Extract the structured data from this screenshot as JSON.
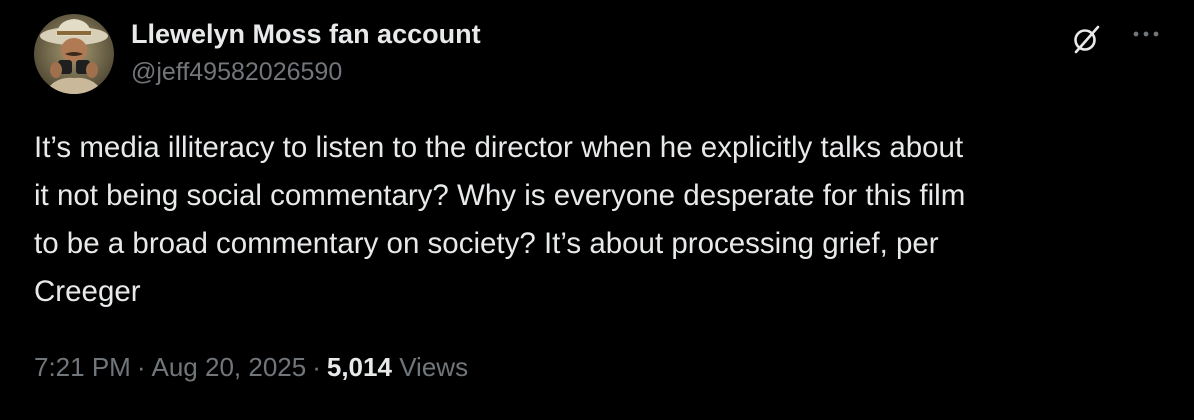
{
  "tweet": {
    "author": {
      "display_name": "Llewelyn Moss fan account",
      "handle": "@jeff49582026590"
    },
    "text": "It’s media illiteracy to listen to the director when he explicitly talks about\nit not being social commentary? Why is everyone desperate for this film\nto be a broad commentary on society? It’s about processing grief, per\nCreeger",
    "time": "7:21 PM",
    "date": "Aug 20, 2025",
    "separator": "·",
    "views_count": "5,014",
    "views_label": "Views",
    "icons": {
      "top_right_1": "grok-icon",
      "top_right_2": "more-horizontal-icon"
    }
  },
  "colors": {
    "background": "#000000",
    "primary_text": "#e7e9ea",
    "secondary_text": "#71767b"
  }
}
